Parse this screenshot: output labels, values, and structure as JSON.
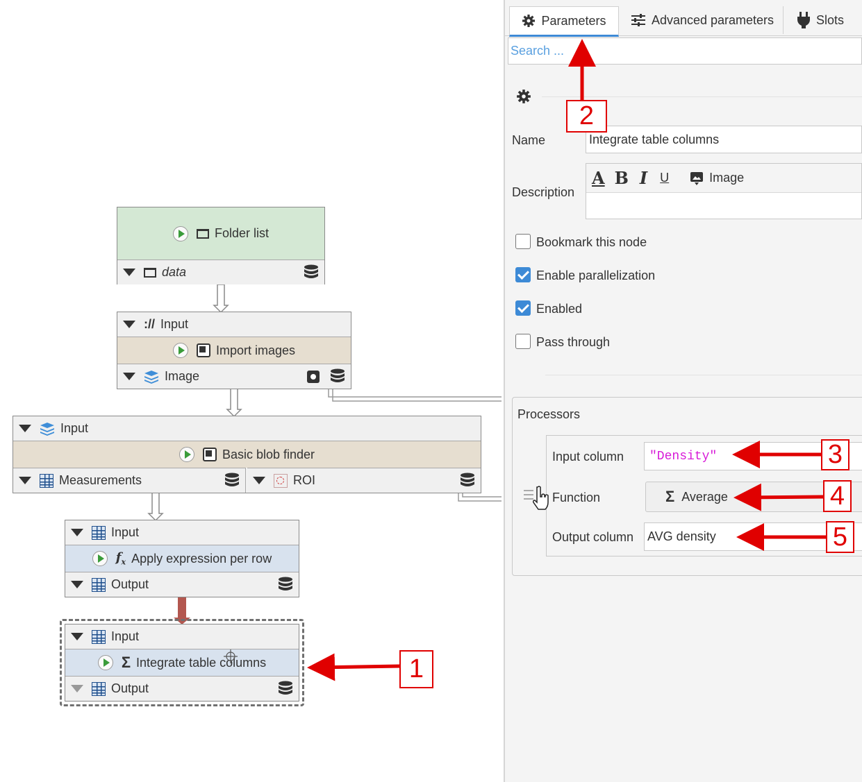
{
  "graph": {
    "folder_list": {
      "title": "Folder list",
      "output_label": "data"
    },
    "import_images": {
      "input_label": "Input",
      "title": "Import images",
      "output_label": "Image"
    },
    "blob_finder": {
      "input_label": "Input",
      "title": "Basic blob finder",
      "output_measurements": "Measurements",
      "output_roi": "ROI"
    },
    "apply_expression": {
      "input_label": "Input",
      "title": "Apply expression per row",
      "output_label": "Output"
    },
    "integrate": {
      "input_label": "Input",
      "title": "Integrate table columns",
      "output_label": "Output"
    },
    "url_icon_text": "://",
    "fx_icon_text": "f",
    "fx_sub": "x",
    "sigma": "Σ",
    "colors": {
      "folder_node": "#d4e8d4",
      "processor_node": "#e6ded0",
      "table_node": "#d8e2ee",
      "selected_border": "#707070",
      "connection": "#b3574f"
    }
  },
  "panel": {
    "tabs": [
      {
        "label": "Parameters",
        "icon": "gear-icon"
      },
      {
        "label": "Advanced parameters",
        "icon": "sliders-icon"
      },
      {
        "label": "Slots",
        "icon": "plug-icon"
      }
    ],
    "search_placeholder": "Search ...",
    "name_label": "Name",
    "name_value": "Integrate table columns",
    "description_label": "Description",
    "toolbar": {
      "font": "A",
      "bold": "B",
      "italic": "I",
      "underline": "U",
      "image": "Image"
    },
    "checkboxes": [
      {
        "label": "Bookmark this node",
        "checked": false
      },
      {
        "label": "Enable parallelization",
        "checked": true
      },
      {
        "label": "Enabled",
        "checked": true
      },
      {
        "label": "Pass through",
        "checked": false
      }
    ],
    "processors": {
      "title": "Processors",
      "input_column_label": "Input column",
      "input_column_value": "\"Density\"",
      "function_label": "Function",
      "function_value": "Average",
      "output_column_label": "Output column",
      "output_column_value": "AVG density"
    },
    "accent_color": "#3d8ad6",
    "expression_color": "#d81bd8"
  },
  "annotations": {
    "c1": "1",
    "c2": "2",
    "c3": "3",
    "c4": "4",
    "c5": "5",
    "arrow_color": "#e00000"
  }
}
